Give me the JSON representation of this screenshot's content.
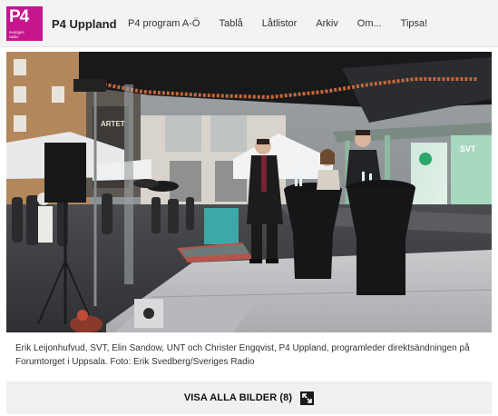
{
  "logo": {
    "mark": "P4",
    "sub_line_1": "sveriges",
    "sub_line_2": "radio"
  },
  "channel": "P4 Uppland",
  "nav": [
    {
      "label": "P4 program A-Ö"
    },
    {
      "label": "Tablå"
    },
    {
      "label": "Låtlistor"
    },
    {
      "label": "Arkiv"
    },
    {
      "label": "Om..."
    },
    {
      "label": "Tipsa!"
    }
  ],
  "photo": {
    "sign_text": "ARTET",
    "banner_text": "SVT"
  },
  "caption": "Erik Leijonhufvud, SVT, Elin Sandow, UNT och Christer Engqvist, P4 Uppland, programleder direktsändningen på Forumtorget i Uppsala. Foto: Erik Svedberg/Sveriges Radio",
  "gallery_button": {
    "label": "VISA ALLA BILDER (8)",
    "icon": "expand-icon"
  },
  "colors": {
    "brand": "#c7158e",
    "nav_bg": "#f3f3f3",
    "button_bg": "#f0f0f0"
  }
}
